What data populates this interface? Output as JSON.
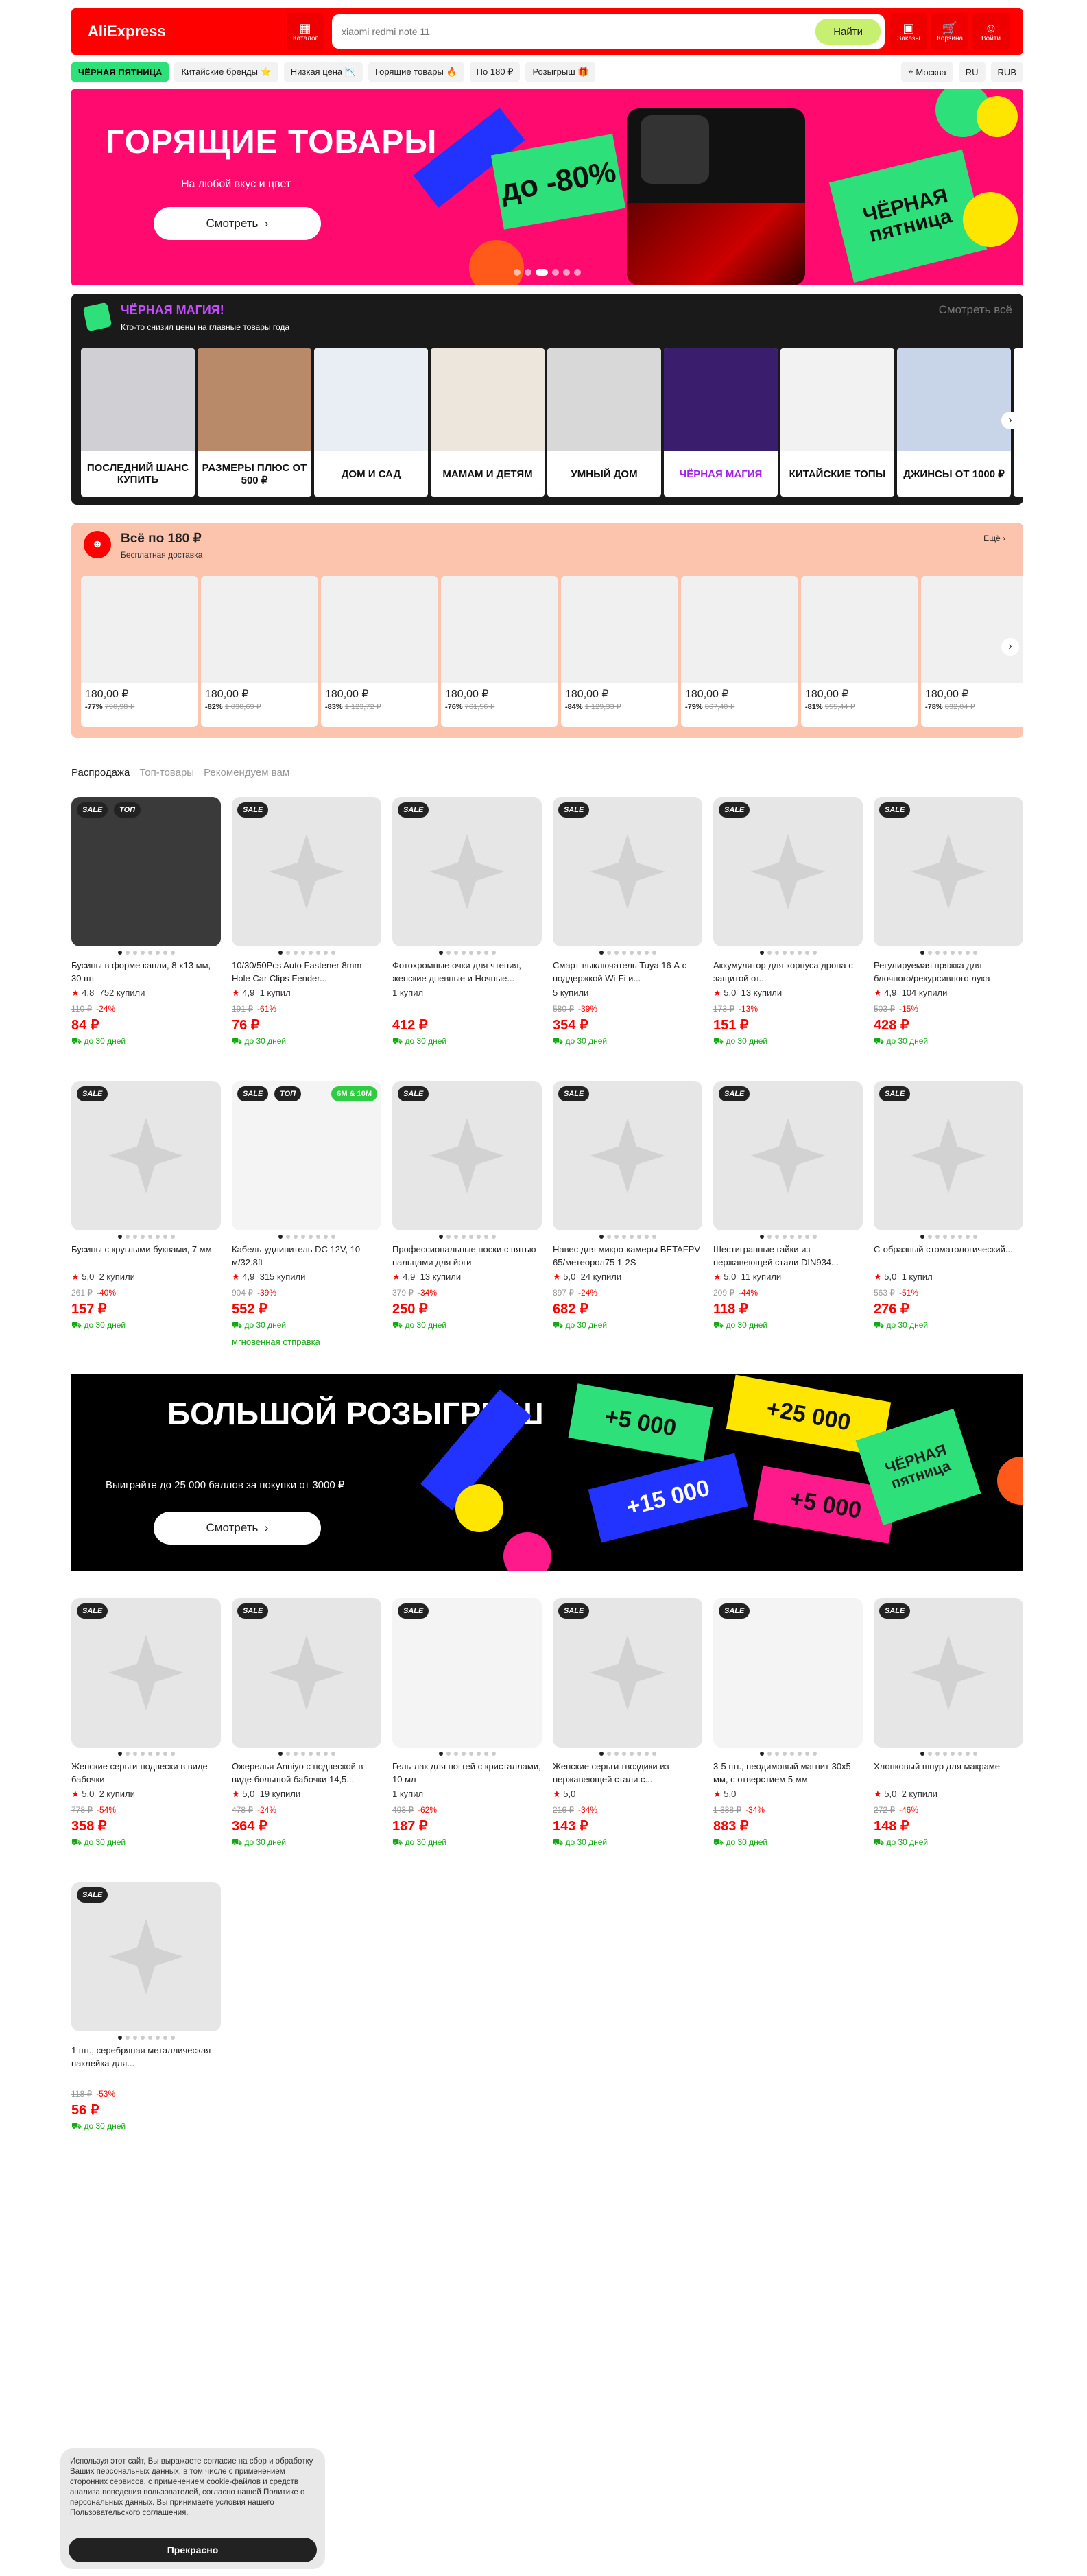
{
  "header": {
    "logo": "AliExpress",
    "catalog": "Каталог",
    "search_placeholder": "xiaomi redmi note 11",
    "search_btn": "Найти",
    "orders": "Заказы",
    "cart": "Корзина",
    "login": "Войти"
  },
  "subnav": {
    "items": [
      "ЧЁРНАЯ ПЯТНИЦА",
      "Китайские бренды ⭐",
      "Низкая цена 📉",
      "Горящие товары 🔥",
      "По 180 ₽",
      "Розыгрыш 🎁"
    ],
    "city": "Москва",
    "lang": "RU",
    "currency": "RUB"
  },
  "hero": {
    "title": "ГОРЯЩИЕ ТОВАРЫ",
    "subtitle": "На любой вкус и цвет",
    "button": "Смотреть",
    "discount": "до -80%",
    "tag": "ЧЁРНАЯ пятница"
  },
  "magic": {
    "title": "ЧЁРНАЯ МАГИЯ!",
    "subtitle": "Кто-то снизил цены на главные товары года",
    "see_all": "Смотреть всё",
    "tiles": [
      "ПОСЛЕДНИЙ ШАНС КУПИТЬ",
      "РАЗМЕРЫ ПЛЮС ОТ 500 ₽",
      "ДОМ И САД",
      "МАМАМ И ДЕТЯМ",
      "УМНЫЙ ДОМ",
      "ЧЁРНАЯ МАГИЯ",
      "КИТАЙСКИЕ ТОПЫ",
      "ДЖИНСЫ ОТ 1000 ₽"
    ]
  },
  "p180": {
    "title": "Всё по 180 ₽",
    "subtitle": "Бесплатная доставка",
    "more": "Ещё",
    "items": [
      {
        "price": "180,00 ₽",
        "pct": "-77%",
        "old": "790,98 ₽"
      },
      {
        "price": "180,00 ₽",
        "pct": "-82%",
        "old": "1 030,69 ₽"
      },
      {
        "price": "180,00 ₽",
        "pct": "-83%",
        "old": "1 123,72 ₽"
      },
      {
        "price": "180,00 ₽",
        "pct": "-76%",
        "old": "761,56 ₽"
      },
      {
        "price": "180,00 ₽",
        "pct": "-84%",
        "old": "1 129,33 ₽"
      },
      {
        "price": "180,00 ₽",
        "pct": "-79%",
        "old": "867,40 ₽"
      },
      {
        "price": "180,00 ₽",
        "pct": "-81%",
        "old": "955,44 ₽"
      },
      {
        "price": "180,00 ₽",
        "pct": "-78%",
        "old": "832,04 ₽"
      }
    ]
  },
  "tabs": [
    "Распродажа",
    "Топ-товары",
    "Рекомендуем вам"
  ],
  "products": [
    {
      "title": "Бусины в форме капли, 8 x13 мм, 30 шт",
      "rating": "4,8",
      "sold": "752 купили",
      "old": "110 ₽",
      "pct": "-24%",
      "price": "84 ₽",
      "delivery": "до 30 дней"
    },
    {
      "title": "10/30/50Pcs Auto Fastener 8mm Hole Car Clips Fender...",
      "rating": "4,9",
      "sold": "1 купил",
      "old": "191 ₽",
      "pct": "-61%",
      "price": "76 ₽",
      "delivery": "до 30 дней"
    },
    {
      "title": "Фотохромные очки для чтения, женские дневные и Ночные...",
      "rating": "",
      "sold": "1 купил",
      "old": "",
      "pct": "",
      "price": "412 ₽",
      "delivery": "до 30 дней"
    },
    {
      "title": "Смарт-выключатель Tuya 16 А с поддержкой Wi-Fi и...",
      "rating": "",
      "sold": "5 купили",
      "old": "580 ₽",
      "pct": "-39%",
      "price": "354 ₽",
      "delivery": "до 30 дней"
    },
    {
      "title": "Аккумулятор для корпуса дрона с защитой от...",
      "rating": "5,0",
      "sold": "13 купили",
      "old": "173 ₽",
      "pct": "-13%",
      "price": "151 ₽",
      "delivery": "до 30 дней"
    },
    {
      "title": "Регулируемая пряжка для блочного/рекурсивного лука",
      "rating": "4,9",
      "sold": "104 купили",
      "old": "503 ₽",
      "pct": "-15%",
      "price": "428 ₽",
      "delivery": "до 30 дней"
    },
    {
      "title": "Бусины с круглыми буквами, 7 мм",
      "rating": "5,0",
      "sold": "2 купили",
      "old": "261 ₽",
      "pct": "-40%",
      "price": "157 ₽",
      "delivery": "до 30 дней"
    },
    {
      "title": "Кабель-удлинитель DC 12V, 10 м/32.8ft",
      "rating": "4,9",
      "sold": "315 купили",
      "old": "904 ₽",
      "pct": "-39%",
      "price": "552 ₽",
      "delivery": "до 30 дней",
      "extra": "мгновенная отправка"
    },
    {
      "title": "Профессиональные носки с пятью пальцами для йоги",
      "rating": "4,9",
      "sold": "13 купили",
      "old": "379 ₽",
      "pct": "-34%",
      "price": "250 ₽",
      "delivery": "до 30 дней"
    },
    {
      "title": "Навес для микро-камеры BETAFPV 65/метеорол75 1-2S",
      "rating": "5,0",
      "sold": "24 купили",
      "old": "897 ₽",
      "pct": "-24%",
      "price": "682 ₽",
      "delivery": "до 30 дней"
    },
    {
      "title": "Шестигранные гайки из нержавеющей стали DIN934...",
      "rating": "5,0",
      "sold": "11 купили",
      "old": "209 ₽",
      "pct": "-44%",
      "price": "118 ₽",
      "delivery": "до 30 дней"
    },
    {
      "title": "С-образный стоматологический...",
      "rating": "5,0",
      "sold": "1 купил",
      "old": "563 ₽",
      "pct": "-51%",
      "price": "276 ₽",
      "delivery": "до 30 дней"
    },
    {
      "title": "Женские серьги-подвески в виде бабочки",
      "rating": "5,0",
      "sold": "2 купили",
      "old": "778 ₽",
      "pct": "-54%",
      "price": "358 ₽",
      "delivery": "до 30 дней"
    },
    {
      "title": "Ожерелья Anniyo с подвеской в виде большой бабочки 14,5...",
      "rating": "5,0",
      "sold": "19 купили",
      "old": "478 ₽",
      "pct": "-24%",
      "price": "364 ₽",
      "delivery": "до 30 дней"
    },
    {
      "title": "Гель-лак для ногтей с кристаллами, 10 мл",
      "rating": "",
      "sold": "1 купил",
      "old": "493 ₽",
      "pct": "-62%",
      "price": "187 ₽",
      "delivery": "до 30 дней"
    },
    {
      "title": "Женские серьги-гвоздики из нержавеющей стали с...",
      "rating": "5,0",
      "sold": "",
      "old": "216 ₽",
      "pct": "-34%",
      "price": "143 ₽",
      "delivery": "до 30 дней"
    },
    {
      "title": "3-5 шт., неодимовый магнит 30x5 мм, с отверстием 5 мм",
      "rating": "5,0",
      "sold": "",
      "old": "1 338 ₽",
      "pct": "-34%",
      "price": "883 ₽",
      "delivery": "до 30 дней"
    },
    {
      "title": "Хлопковый шнур для макраме",
      "rating": "5,0",
      "sold": "2 купили",
      "old": "272 ₽",
      "pct": "-46%",
      "price": "148 ₽",
      "delivery": "до 30 дней"
    },
    {
      "title": "1 шт., серебряная металлическая наклейка для...",
      "rating": "",
      "sold": "",
      "old": "118 ₽",
      "pct": "-53%",
      "price": "56 ₽",
      "delivery": "до 30 дней"
    }
  ],
  "promo": {
    "title": "БОЛЬШОЙ РОЗЫГРЫШ",
    "subtitle": "Выиграйте до 25 000 баллов за покупки от 3000 ₽",
    "button": "Смотреть",
    "t1": "+5 000",
    "t2": "+25 000",
    "t3": "+15 000",
    "t4": "+5 000"
  },
  "badges": {
    "sale": "SALE",
    "top": "ТОП",
    "len": "6M & 10M"
  },
  "cookie": {
    "text": "Используя этот сайт, Вы выражаете согласие на сбор и обработку Ваших персональных данных, в том числе с применением сторонних сервисов, с применением cookie-файлов и средств анализа поведения пользователей, согласно нашей Политике о персональных данных. Вы принимаете условия нашего Пользовательского соглашения.",
    "button": "Прекрасно"
  },
  "colors": {
    "brand": "#ff0000",
    "accent": "#c8f070",
    "pink": "#ff0a6e",
    "green": "#12a812"
  }
}
